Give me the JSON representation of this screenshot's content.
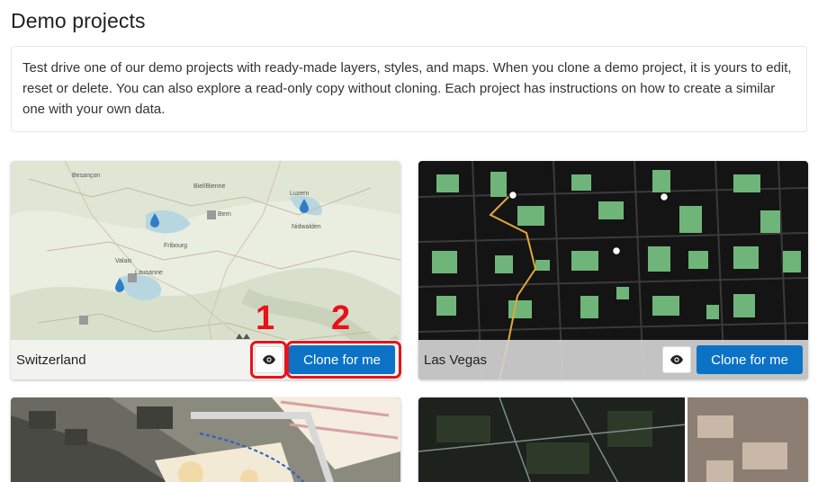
{
  "page": {
    "title": "Demo projects",
    "intro": "Test drive one of our demo projects with ready-made layers, styles, and maps. When you clone a demo project, it is yours to edit, reset or delete. You can also explore a read-only copy without cloning. Each project has instructions on how to create a similar one with your own data."
  },
  "cards": [
    {
      "name": "Switzerland",
      "clone_label": "Clone for me",
      "map_labels": [
        "Besançon",
        "Biel/Bienne",
        "Bern",
        "Luzern",
        "Fribourg",
        "Lausanne",
        "Nidwalden",
        "Valais"
      ]
    },
    {
      "name": "Las Vegas",
      "clone_label": "Clone for me"
    }
  ],
  "annotations": {
    "first": "1",
    "second": "2"
  },
  "colors": {
    "accent": "#0b72c6",
    "callout": "#e8121a"
  },
  "icons": {
    "preview": "eye-icon"
  }
}
